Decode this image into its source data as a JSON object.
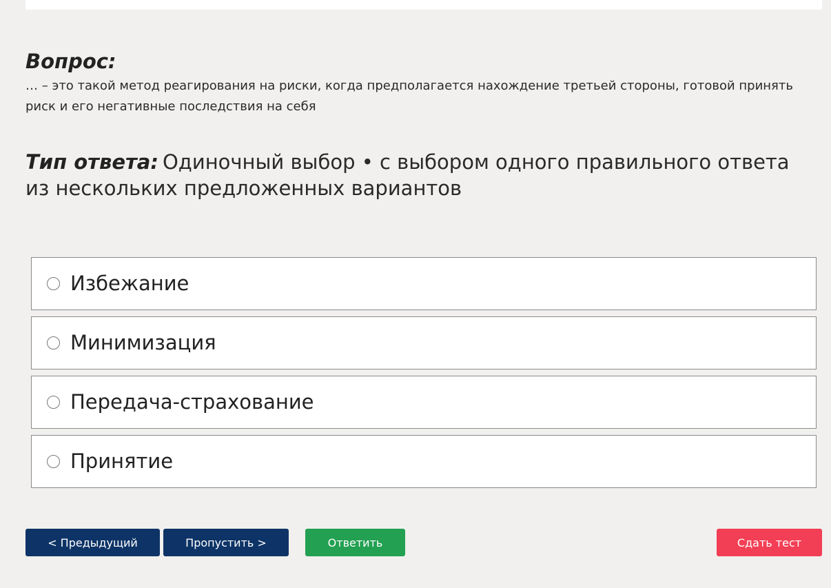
{
  "question": {
    "heading": "Вопрос:",
    "text": "… – это такой метод реагирования на риски, когда предполагается нахождение третьей стороны, готовой принять риск и его негативные последствия на себя"
  },
  "answer_type": {
    "label": "Тип ответа:",
    "value": "Одиночный выбор • с выбором одного правильного ответа из нескольких предложенных вариантов"
  },
  "options": [
    {
      "label": "Избежание"
    },
    {
      "label": "Минимизация"
    },
    {
      "label": "Передача-страхование"
    },
    {
      "label": "Принятие"
    }
  ],
  "buttons": {
    "prev": "< Предыдущий",
    "skip": "Пропустить >",
    "answer": "Ответить",
    "submit": "Сдать тест"
  },
  "colors": {
    "background": "#f1f0ee",
    "nav_button": "#0e3467",
    "answer_button": "#23a052",
    "submit_button": "#f23f55"
  }
}
